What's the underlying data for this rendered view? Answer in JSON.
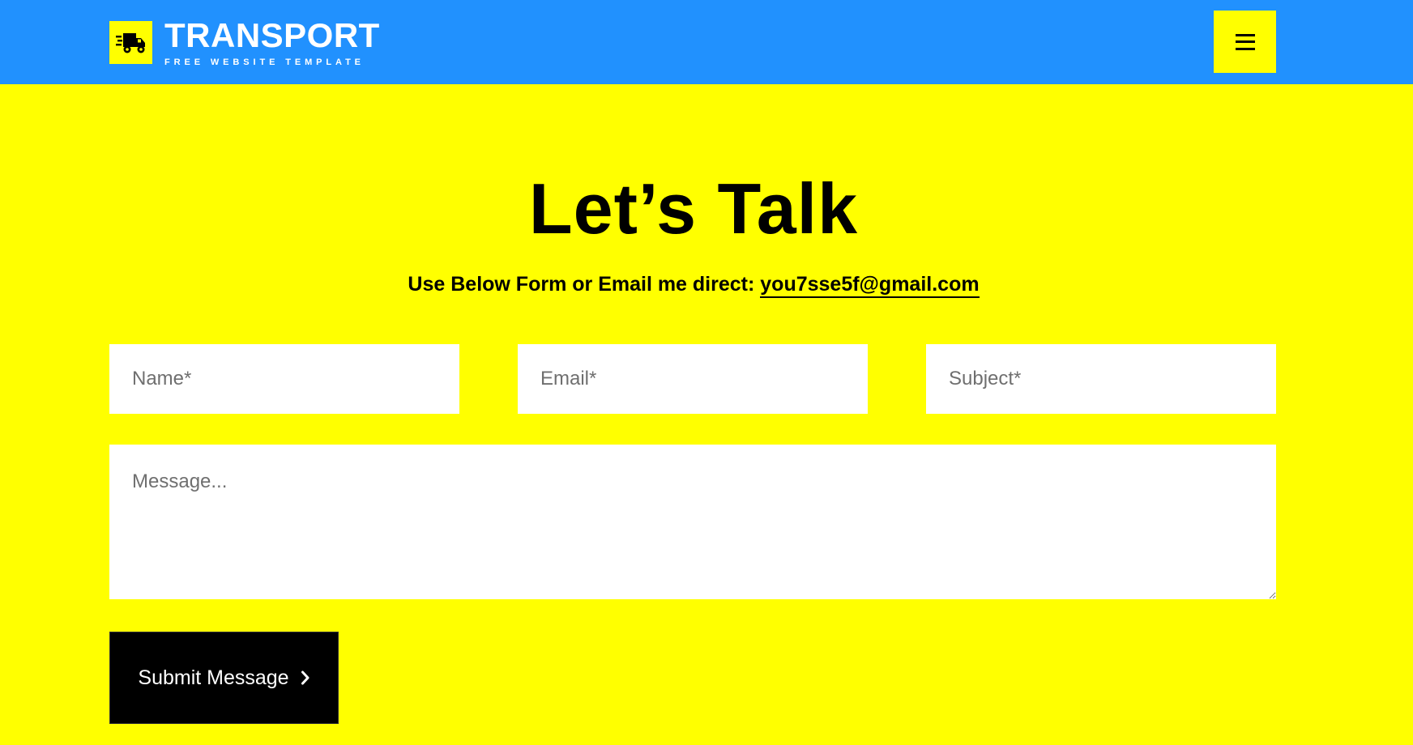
{
  "header": {
    "logo_icon": "delivery-truck-icon",
    "logo_title": "TRANSPORT",
    "logo_subtitle": "FREE WEBSITE TEMPLATE",
    "menu_icon": "hamburger-menu-icon",
    "colors": {
      "bar": "#2191fe",
      "accent": "#ffff00"
    }
  },
  "contact": {
    "title": "Let’s Talk",
    "subtitle_text": "Use Below Form or Email me direct: ",
    "email_link": "you7sse5f@gmail.com",
    "background": "#ffff00"
  },
  "form": {
    "name_placeholder": "Name*",
    "email_placeholder": "Email*",
    "subject_placeholder": "Subject*",
    "message_placeholder": "Message...",
    "submit_label": "Submit Message",
    "submit_icon": "chevron-right-icon"
  }
}
